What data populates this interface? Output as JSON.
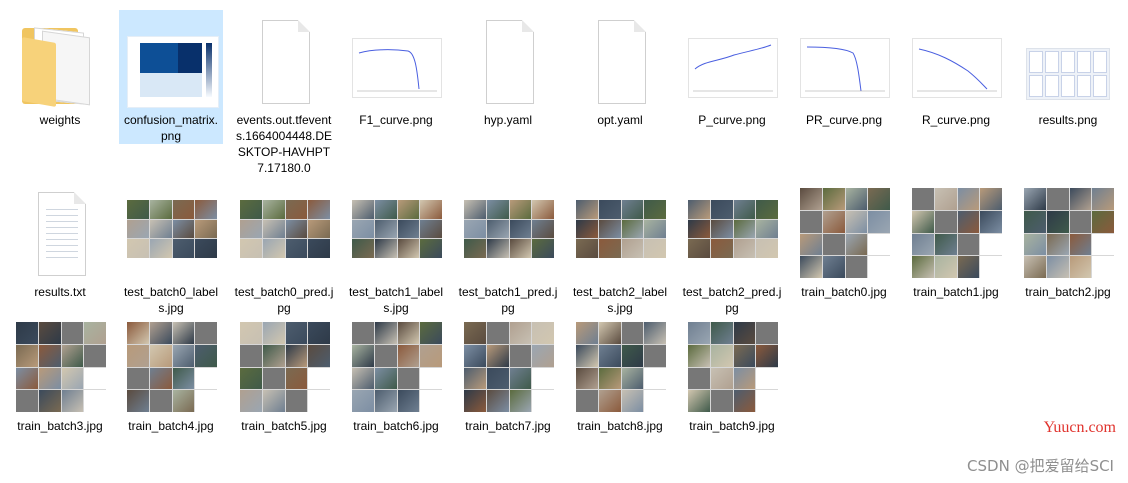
{
  "files": [
    {
      "name": "weights",
      "type": "folder"
    },
    {
      "name": "confusion_matrix.png",
      "type": "png",
      "selected": true
    },
    {
      "name": "events.out.tfevents.1664004448.DESKTOP-HAVHPT7.17180.0",
      "type": "file"
    },
    {
      "name": "F1_curve.png",
      "type": "png"
    },
    {
      "name": "hyp.yaml",
      "type": "file"
    },
    {
      "name": "opt.yaml",
      "type": "file"
    },
    {
      "name": "P_curve.png",
      "type": "png"
    },
    {
      "name": "PR_curve.png",
      "type": "png"
    },
    {
      "name": "R_curve.png",
      "type": "png"
    },
    {
      "name": "results.png",
      "type": "png"
    },
    {
      "name": "results.txt",
      "type": "txt"
    },
    {
      "name": "test_batch0_labels.jpg",
      "type": "jpg"
    },
    {
      "name": "test_batch0_pred.jpg",
      "type": "jpg"
    },
    {
      "name": "test_batch1_labels.jpg",
      "type": "jpg"
    },
    {
      "name": "test_batch1_pred.jpg",
      "type": "jpg"
    },
    {
      "name": "test_batch2_labels.jpg",
      "type": "jpg"
    },
    {
      "name": "test_batch2_pred.jpg",
      "type": "jpg"
    },
    {
      "name": "train_batch0.jpg",
      "type": "jpg"
    },
    {
      "name": "train_batch1.jpg",
      "type": "jpg"
    },
    {
      "name": "train_batch2.jpg",
      "type": "jpg"
    },
    {
      "name": "train_batch3.jpg",
      "type": "jpg"
    },
    {
      "name": "train_batch4.jpg",
      "type": "jpg"
    },
    {
      "name": "train_batch5.jpg",
      "type": "jpg"
    },
    {
      "name": "train_batch6.jpg",
      "type": "jpg"
    },
    {
      "name": "train_batch7.jpg",
      "type": "jpg"
    },
    {
      "name": "train_batch8.jpg",
      "type": "jpg"
    },
    {
      "name": "train_batch9.jpg",
      "type": "jpg"
    }
  ],
  "watermarks": {
    "site": "Yuucn.com",
    "credit": "CSDN @把爱留给SCI"
  },
  "colors": {
    "selection": "#cce8ff",
    "curve": "#4a5fe0",
    "folder": "#f0c560",
    "site_watermark": "#e0332d"
  }
}
